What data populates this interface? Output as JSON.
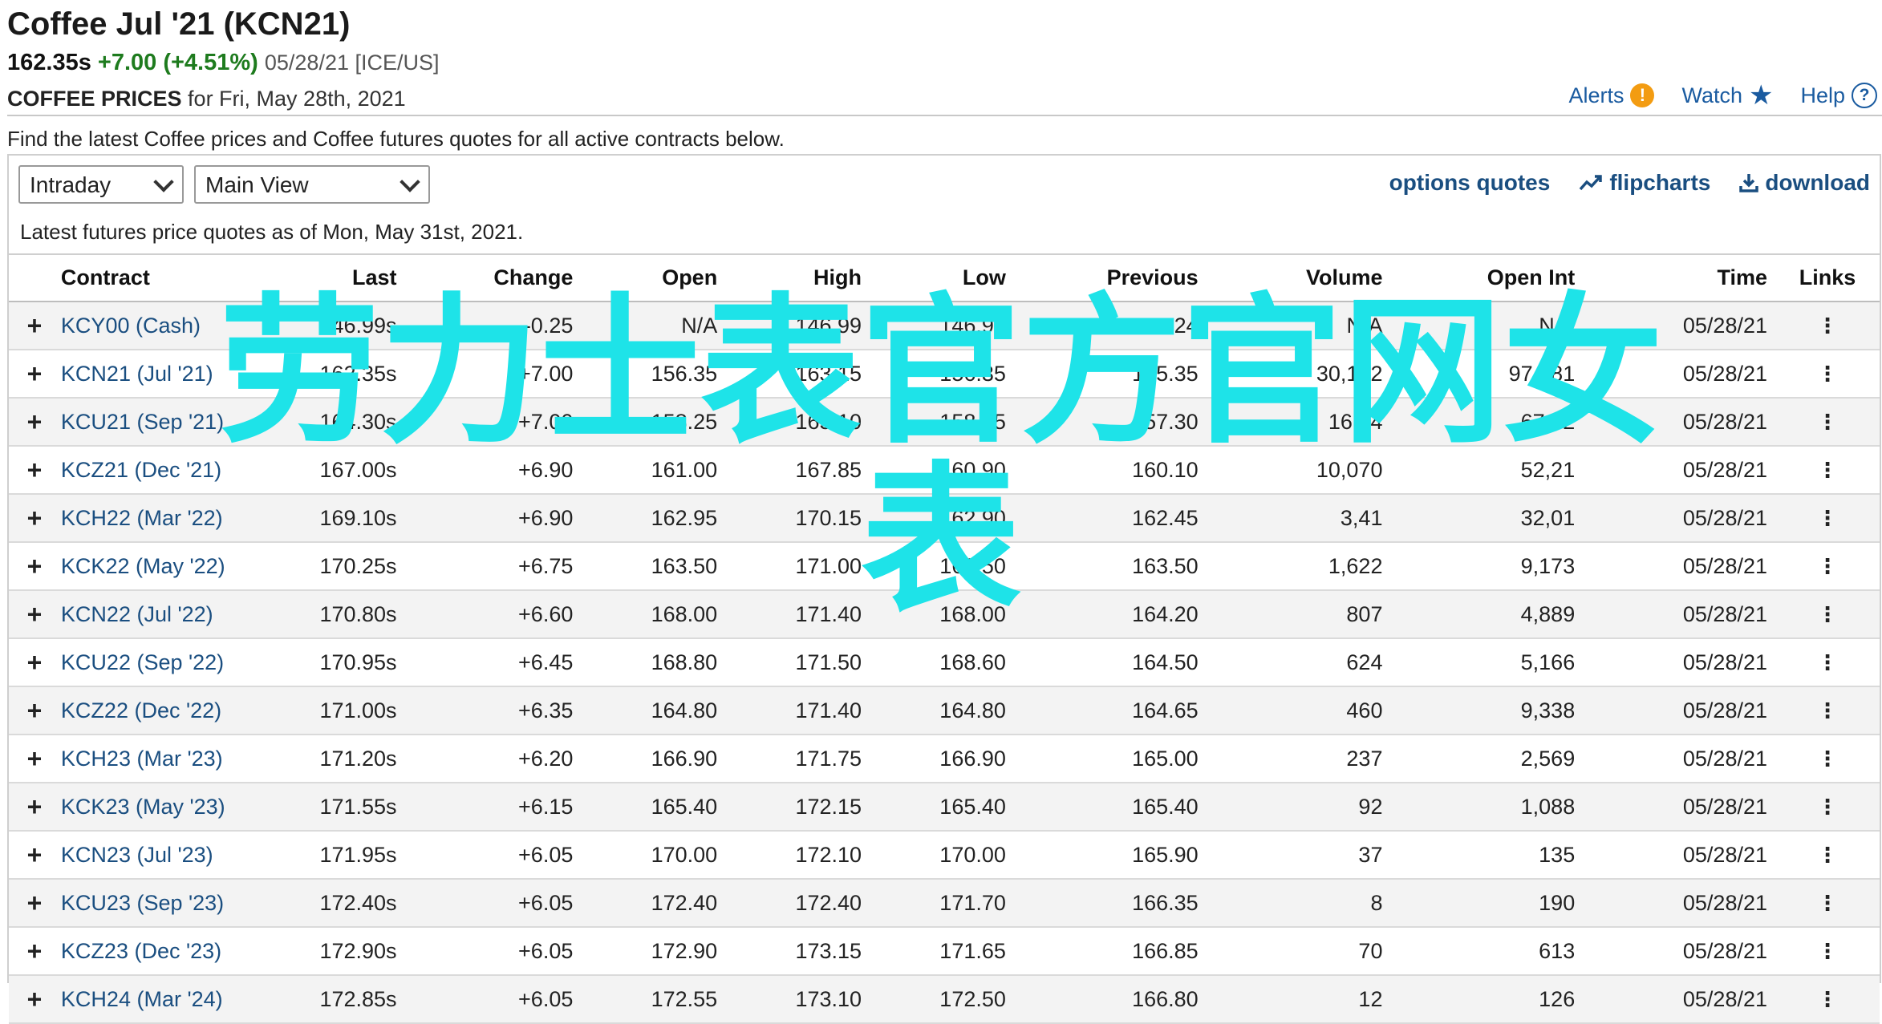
{
  "header": {
    "title": "Coffee Jul '21 (KCN21)",
    "last": "162.35s",
    "change": "+7.00 (+4.51%)",
    "meta": "05/28/21 [ICE/US]",
    "prices_label": "COFFEE PRICES",
    "prices_date": "for Fri, May 28th, 2021",
    "links": {
      "alerts": "Alerts",
      "watch": "Watch",
      "help": "Help"
    }
  },
  "intro": "Find the latest Coffee prices and Coffee futures quotes for all active contracts below.",
  "controls": {
    "period_select": "Intraday",
    "view_select": "Main View",
    "options_quotes": "options quotes",
    "flipcharts": "flipcharts",
    "download": "download"
  },
  "asof": "Latest futures price quotes as of Mon, May 31st, 2021.",
  "table": {
    "headers": [
      "Contract",
      "Last",
      "Change",
      "Open",
      "High",
      "Low",
      "Previous",
      "Volume",
      "Open Int",
      "Time",
      "Links"
    ],
    "rows": [
      {
        "contract": "KCY00 (Cash)",
        "last": "146.99s",
        "change": "-0.25",
        "open": "N/A",
        "high": "146.99",
        "low": "146.99",
        "previous": "147.24",
        "volume": "N/A",
        "open_int": "N/A",
        "time": "05/28/21"
      },
      {
        "contract": "KCN21 (Jul '21)",
        "last": "162.35s",
        "change": "+7.00",
        "open": "156.35",
        "high": "163.15",
        "low": "156.35",
        "previous": "155.35",
        "volume": "30,122",
        "open_int": "97,881",
        "time": "05/28/21"
      },
      {
        "contract": "KCU21 (Sep '21)",
        "last": "164.30s",
        "change": "+7.00",
        "open": "158.25",
        "high": "165.10",
        "low": "158.25",
        "previous": "157.30",
        "volume": "16,44",
        "open_int": "67,62",
        "time": "05/28/21"
      },
      {
        "contract": "KCZ21 (Dec '21)",
        "last": "167.00s",
        "change": "+6.90",
        "open": "161.00",
        "high": "167.85",
        "low": "160.90",
        "previous": "160.10",
        "volume": "10,070",
        "open_int": "52,21",
        "time": "05/28/21"
      },
      {
        "contract": "KCH22 (Mar '22)",
        "last": "169.10s",
        "change": "+6.90",
        "open": "162.95",
        "high": "170.15",
        "low": "162.90",
        "previous": "162.45",
        "volume": "3,41",
        "open_int": "32,01",
        "time": "05/28/21"
      },
      {
        "contract": "KCK22 (May '22)",
        "last": "170.25s",
        "change": "+6.75",
        "open": "163.50",
        "high": "171.00",
        "low": "163.50",
        "previous": "163.50",
        "volume": "1,622",
        "open_int": "9,173",
        "time": "05/28/21"
      },
      {
        "contract": "KCN22 (Jul '22)",
        "last": "170.80s",
        "change": "+6.60",
        "open": "168.00",
        "high": "171.40",
        "low": "168.00",
        "previous": "164.20",
        "volume": "807",
        "open_int": "4,889",
        "time": "05/28/21"
      },
      {
        "contract": "KCU22 (Sep '22)",
        "last": "170.95s",
        "change": "+6.45",
        "open": "168.80",
        "high": "171.50",
        "low": "168.60",
        "previous": "164.50",
        "volume": "624",
        "open_int": "5,166",
        "time": "05/28/21"
      },
      {
        "contract": "KCZ22 (Dec '22)",
        "last": "171.00s",
        "change": "+6.35",
        "open": "164.80",
        "high": "171.40",
        "low": "164.80",
        "previous": "164.65",
        "volume": "460",
        "open_int": "9,338",
        "time": "05/28/21"
      },
      {
        "contract": "KCH23 (Mar '23)",
        "last": "171.20s",
        "change": "+6.20",
        "open": "166.90",
        "high": "171.75",
        "low": "166.90",
        "previous": "165.00",
        "volume": "237",
        "open_int": "2,569",
        "time": "05/28/21"
      },
      {
        "contract": "KCK23 (May '23)",
        "last": "171.55s",
        "change": "+6.15",
        "open": "165.40",
        "high": "172.15",
        "low": "165.40",
        "previous": "165.40",
        "volume": "92",
        "open_int": "1,088",
        "time": "05/28/21"
      },
      {
        "contract": "KCN23 (Jul '23)",
        "last": "171.95s",
        "change": "+6.05",
        "open": "170.00",
        "high": "172.10",
        "low": "170.00",
        "previous": "165.90",
        "volume": "37",
        "open_int": "135",
        "time": "05/28/21"
      },
      {
        "contract": "KCU23 (Sep '23)",
        "last": "172.40s",
        "change": "+6.05",
        "open": "172.40",
        "high": "172.40",
        "low": "171.70",
        "previous": "166.35",
        "volume": "8",
        "open_int": "190",
        "time": "05/28/21"
      },
      {
        "contract": "KCZ23 (Dec '23)",
        "last": "172.90s",
        "change": "+6.05",
        "open": "172.90",
        "high": "173.15",
        "low": "171.65",
        "previous": "166.85",
        "volume": "70",
        "open_int": "613",
        "time": "05/28/21"
      },
      {
        "contract": "KCH24 (Mar '24)",
        "last": "172.85s",
        "change": "+6.05",
        "open": "172.55",
        "high": "173.10",
        "low": "172.50",
        "previous": "166.80",
        "volume": "12",
        "open_int": "126",
        "time": "05/28/21"
      }
    ]
  },
  "overlay": {
    "line1": "劳力士表官方官网女",
    "line2": "表"
  },
  "colors": {
    "link": "#1a4e80",
    "positive": "#2e8b2e",
    "negative": "#d01c1c",
    "overlay": "#1ee3e8"
  },
  "icons": [
    "plus-icon",
    "kebab-icon",
    "alert-icon",
    "star-icon",
    "help-icon",
    "chevron-down-icon",
    "flipchart-icon",
    "download-icon"
  ]
}
